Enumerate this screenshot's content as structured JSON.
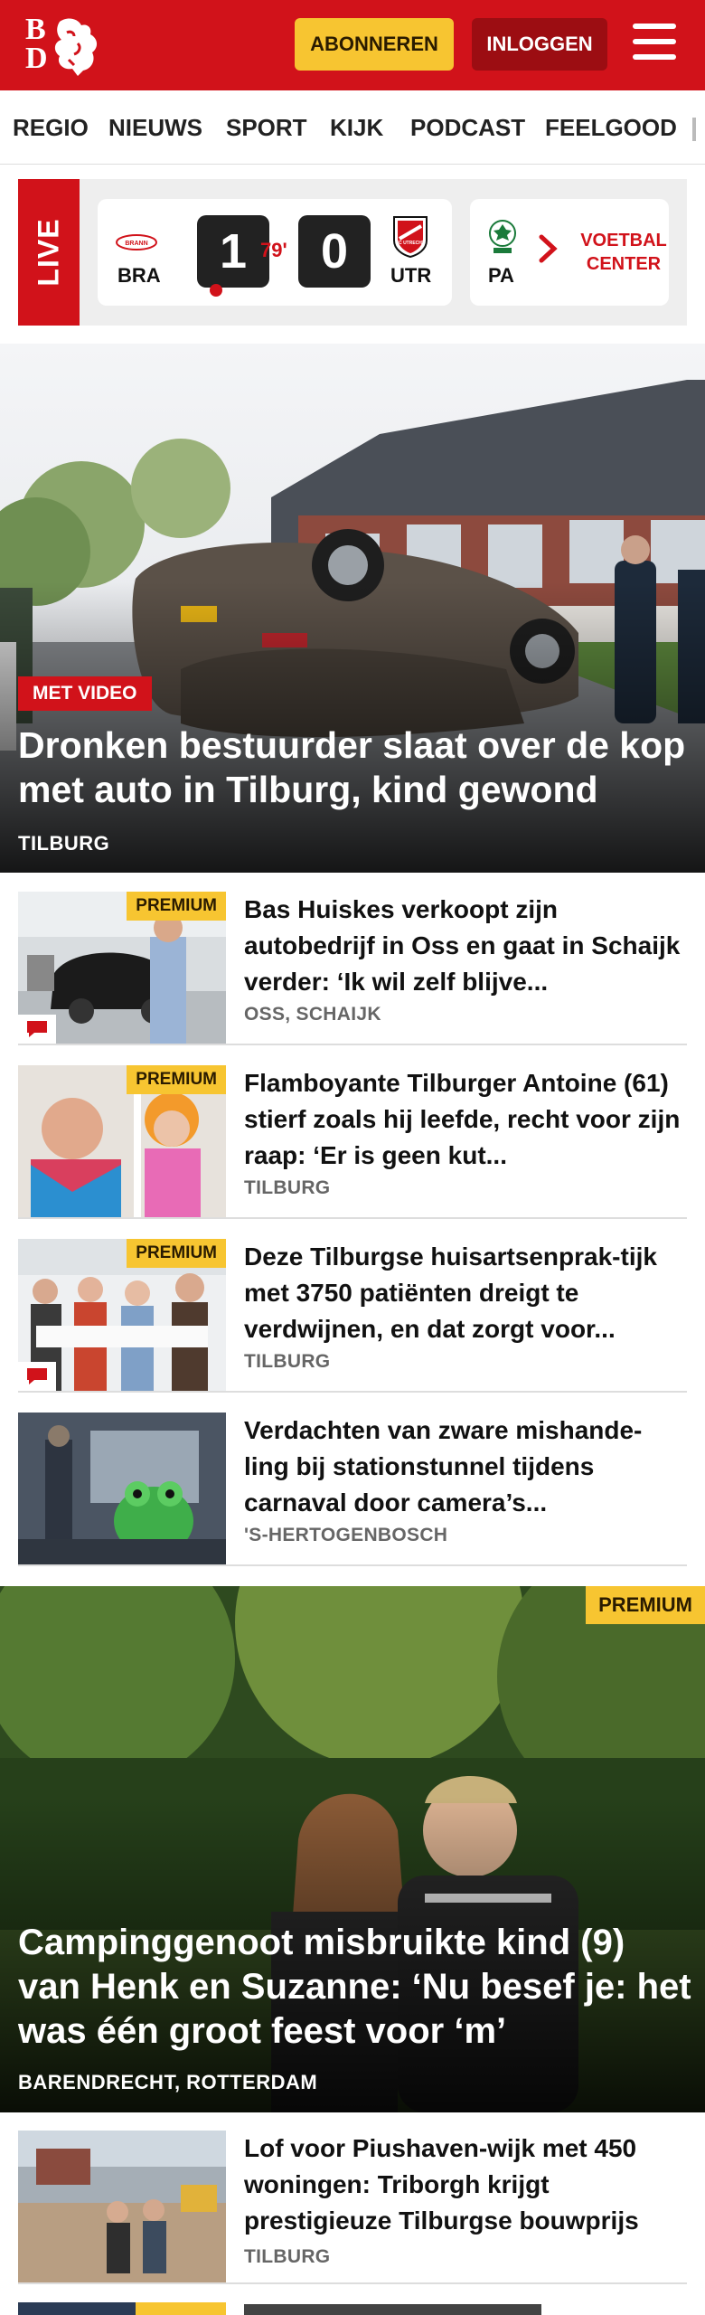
{
  "header": {
    "logo_text": "BD",
    "subscribe_label": "ABONNEREN",
    "login_label": "INLOGGEN",
    "menu_icon": "hamburger-menu-icon",
    "colors": {
      "brand_red": "#d1121a",
      "premium_yellow": "#f7c531",
      "login_dark_red": "#9c0d12"
    }
  },
  "nav": {
    "items": [
      {
        "label": "REGIO"
      },
      {
        "label": "NIEUWS"
      },
      {
        "label": "SPORT"
      },
      {
        "label": "KIJK"
      },
      {
        "label": "PODCAST"
      },
      {
        "label": "FEELGOOD"
      }
    ]
  },
  "live": {
    "label": "LIVE",
    "match": {
      "home": {
        "name": "BRA",
        "logo_text": "BRANN"
      },
      "away": {
        "name": "UTR",
        "logo_text": "FC UTRECHT"
      },
      "home_score": "1",
      "away_score": "0",
      "minute": "79'"
    },
    "next_match": {
      "home": {
        "name": "PA"
      }
    },
    "scroll_icon": "chevron-right-icon",
    "voetbal_center_label": "VOETBAL\nCENTER"
  },
  "hero": {
    "badge": "MET VIDEO",
    "title": "Dronken bestuurder slaat over de kop met auto in Tilburg, kind gewond",
    "location": "TILBURG"
  },
  "articles": [
    {
      "premium": "PREMIUM",
      "title": "Bas Huiskes verkoopt zijn autobedrijf in Oss en gaat in Schaijk verder: ‘Ik wil zelf blijve...",
      "location": "OSS, SCHAIJK",
      "has_comments": true
    },
    {
      "premium": "PREMIUM",
      "title": "Flamboyante Tilburger Antoine (61) stierf zoals hij leefde, recht voor zijn raap: ‘Er is geen kut...",
      "location": "TILBURG",
      "has_comments": false
    },
    {
      "premium": "PREMIUM",
      "title": "Deze Tilburgse huisartsenprak-tijk met 3750 patiënten dreigt te verdwijnen, en dat zorgt voor...",
      "location": "TILBURG",
      "has_comments": true
    },
    {
      "premium": "",
      "title": "Verdachten van zware mishande-ling bij stationstunnel tijdens carnaval door camera’s...",
      "location": "'S-HERTOGENBOSCH",
      "has_comments": false
    }
  ],
  "feature": {
    "premium": "PREMIUM",
    "title": "Campinggenoot misbruikte kind (9) van Henk en Suzanne: ‘Nu besef je: het was één groot feest voor ‘m’",
    "location": "BARENDRECHT, ROTTERDAM"
  },
  "articles2": [
    {
      "title": "Lof voor Piushaven-wijk met 450 woningen: Triborgh krijgt prestigieuze Tilburgse bouwprijs",
      "location": "TILBURG"
    }
  ]
}
